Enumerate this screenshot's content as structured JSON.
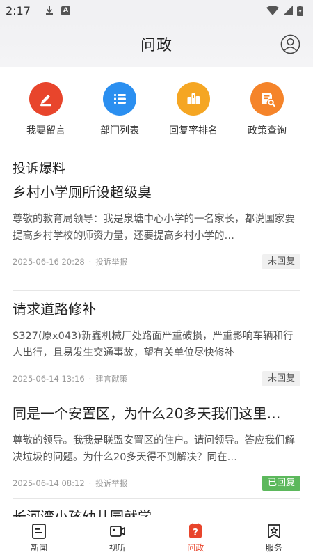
{
  "status_bar": {
    "time": "2:17"
  },
  "header": {
    "title": "问政"
  },
  "quick_actions": [
    {
      "label": "我要留言",
      "icon": "pencil-icon",
      "color": "#e8452c"
    },
    {
      "label": "部门列表",
      "icon": "list-icon",
      "color": "#2b8ff0"
    },
    {
      "label": "回复率排名",
      "icon": "ranking-icon",
      "color": "#f5a623"
    },
    {
      "label": "政策查询",
      "icon": "document-search-icon",
      "color": "#f5842a"
    }
  ],
  "section": {
    "title": "投诉爆料"
  },
  "posts": [
    {
      "title": "乡村小学厕所设超级臭",
      "body": "尊敬的教育局领导：我是泉塘中心小学的一名家长，都说国家要提高乡村学校的师资力量，还要提高乡村小学的…",
      "date": "2025-06-16 20:28",
      "category": "投诉举报",
      "status": "未回复"
    },
    {
      "title": "请求道路修补",
      "body": "S327(原x043)新鑫机械厂处路面严重破损，严重影响车辆和行人出行，且易发生交通事故，望有关单位尽快修补",
      "date": "2025-06-14 13:16",
      "category": "建言献策",
      "status": "未回复"
    },
    {
      "title": "同是一个安置区，为什么20多天我们这里…",
      "body": "尊敬的领导。我我是联盟安置区的住户。请问领导。答应我们解决垃圾的问题。为什么20多天得不到解决？同在…",
      "date": "2025-06-14 08:12",
      "category": "投诉举报",
      "status": "已回复"
    },
    {
      "title": "长河湾小孩幼儿园就学"
    }
  ],
  "bottom_nav": [
    {
      "label": "新闻",
      "icon": "news-icon"
    },
    {
      "label": "视听",
      "icon": "video-icon"
    },
    {
      "label": "问政",
      "icon": "question-icon",
      "active": true
    },
    {
      "label": "服务",
      "icon": "service-icon"
    }
  ],
  "colors": {
    "accent": "#e8452c",
    "replied": "#5cb85c"
  }
}
